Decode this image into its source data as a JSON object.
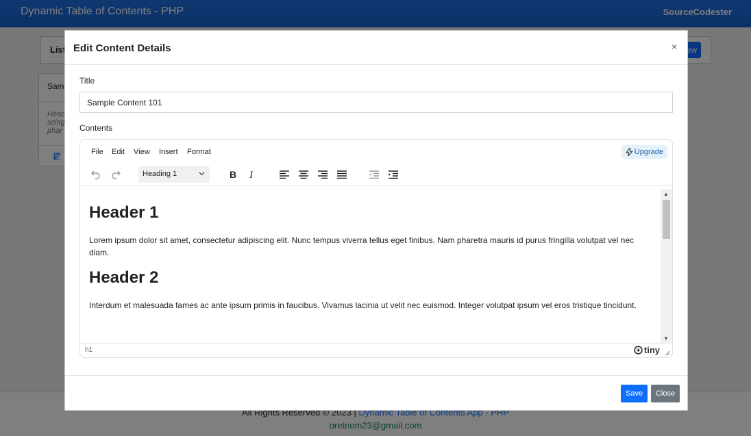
{
  "background": {
    "nav_title": "Dynamic Table of Contents - PHP",
    "brand": "SourceCodester",
    "card_label": "List",
    "new_btn": "ew",
    "item_title": "Sam",
    "item_desc": "Head scing phar",
    "footer_text": "All Rights Reserved © 2023 | ",
    "footer_app": "Dynamic Table of Contents App - PHP",
    "footer_email": "oretnom23@gmail.com"
  },
  "modal": {
    "title": "Edit Content Details",
    "close_glyph": "×",
    "title_label": "Title",
    "title_value": "Sample Content 101",
    "contents_label": "Contents",
    "save": "Save",
    "close": "Close"
  },
  "editor": {
    "menu": [
      "File",
      "Edit",
      "View",
      "Insert",
      "Format"
    ],
    "upgrade": "Upgrade",
    "block_format": "Heading 1",
    "path": "h1",
    "brand": "tiny",
    "content": {
      "h1": "Header 1",
      "p1": "Lorem ipsum dolor sit amet, consectetur adipiscing elit. Nunc tempus viverra tellus eget finibus. Nam pharetra mauris id purus fringilla volutpat vel nec diam.",
      "h2": "Header 2",
      "p2": "Interdum et malesuada fames ac ante ipsum primis in faucibus. Vivamus lacinia ut velit nec euismod. Integer volutpat ipsum vel eros tristique tincidunt."
    }
  },
  "colors": {
    "primary": "#0d6efd",
    "secondary": "#6c757d",
    "navbar": "#1560d0"
  }
}
